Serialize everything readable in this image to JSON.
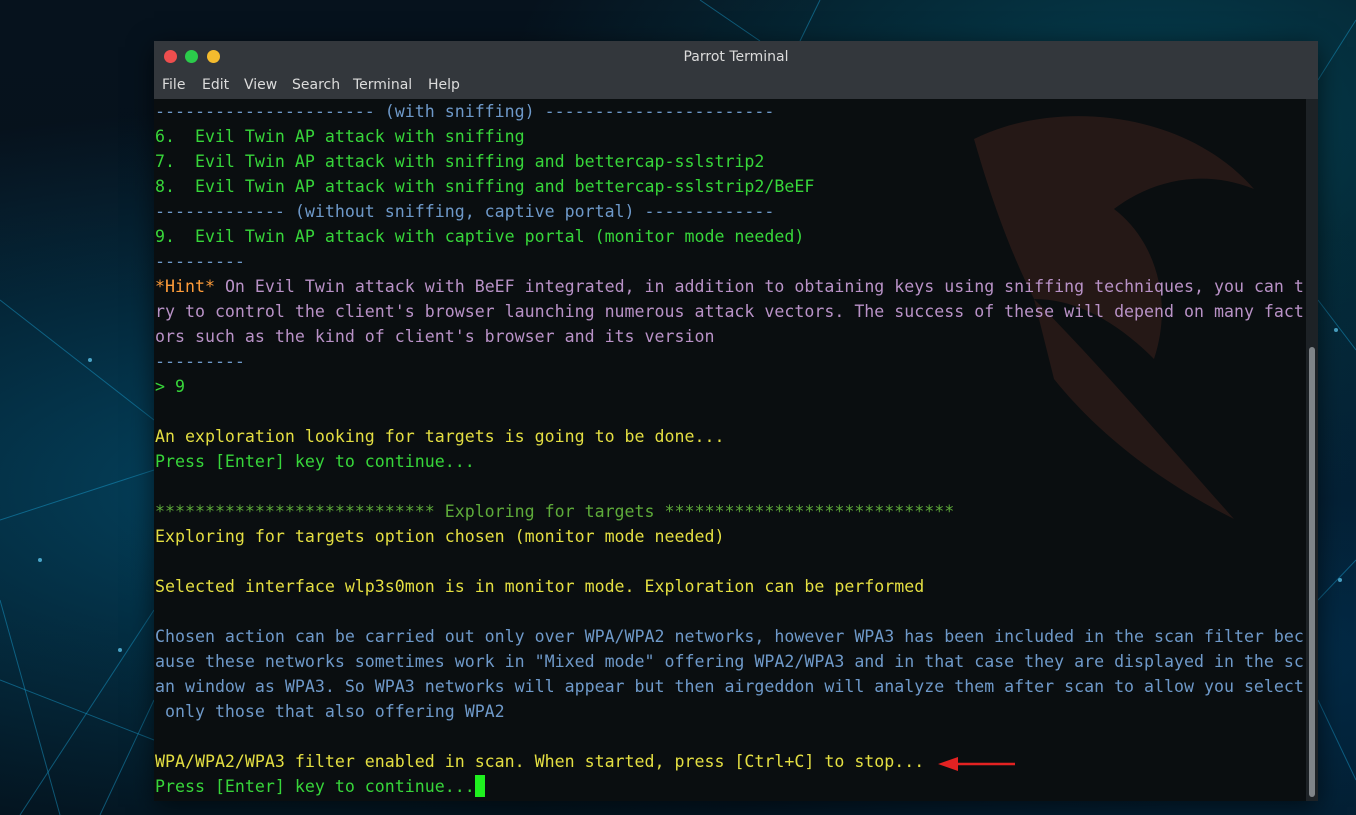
{
  "window": {
    "title": "Parrot Terminal"
  },
  "menu": [
    "File",
    "Edit",
    "View",
    "Search",
    "Terminal",
    "Help"
  ],
  "terminal": {
    "lines": [
      {
        "text": "---------------------- (with sniffing) -----------------------",
        "color": "blue"
      },
      {
        "text": "6.  Evil Twin AP attack with sniffing",
        "color": "green"
      },
      {
        "text": "7.  Evil Twin AP attack with sniffing and bettercap-sslstrip2",
        "color": "green"
      },
      {
        "text": "8.  Evil Twin AP attack with sniffing and bettercap-sslstrip2/BeEF",
        "color": "green"
      },
      {
        "text": "------------- (without sniffing, captive portal) -------------",
        "color": "blue"
      },
      {
        "text": "9.  Evil Twin AP attack with captive portal (monitor mode needed)",
        "color": "green"
      },
      {
        "text": "---------",
        "color": "blue"
      },
      {
        "prefix": "*Hint*",
        "text": " On Evil Twin attack with BeEF integrated, in addition to obtaining keys using sniffing techniques, you can t",
        "color": "purple"
      },
      {
        "text": "ry to control the client's browser launching numerous attack vectors. The success of these will depend on many fact",
        "color": "purple"
      },
      {
        "text": "ors such as the kind of client's browser and its version",
        "color": "purple"
      },
      {
        "text": "---------",
        "color": "blue"
      },
      {
        "text": "> 9",
        "color": "green"
      },
      {
        "text": "",
        "color": "blue"
      },
      {
        "text": "An exploration looking for targets is going to be done...",
        "color": "yellow"
      },
      {
        "text": "Press [Enter] key to continue...",
        "color": "green"
      },
      {
        "text": "",
        "color": "blue"
      },
      {
        "text": "**************************** Exploring for targets *****************************",
        "color": "dim-green"
      },
      {
        "text": "Exploring for targets option chosen (monitor mode needed)",
        "color": "yellow"
      },
      {
        "text": "",
        "color": "blue"
      },
      {
        "text": "Selected interface wlp3s0mon is in monitor mode. Exploration can be performed",
        "color": "yellow"
      },
      {
        "text": "",
        "color": "blue"
      },
      {
        "text": "Chosen action can be carried out only over WPA/WPA2 networks, however WPA3 has been included in the scan filter bec",
        "color": "blue"
      },
      {
        "text": "ause these networks sometimes work in \"Mixed mode\" offering WPA2/WPA3 and in that case they are displayed in the sc",
        "color": "blue"
      },
      {
        "text": "an window as WPA3. So WPA3 networks will appear but then airgeddon will analyze them after scan to allow you select",
        "color": "blue"
      },
      {
        "text": " only those that also offering WPA2",
        "color": "blue"
      },
      {
        "text": "",
        "color": "blue"
      },
      {
        "text": "WPA/WPA2/WPA3 filter enabled in scan. When started, press [Ctrl+C] to stop...",
        "color": "yellow"
      },
      {
        "text": "Press [Enter] key to continue...",
        "color": "green",
        "cursor": true
      }
    ]
  },
  "colors": {
    "blue": "#6e99c9",
    "green": "#37d63a",
    "yellow": "#e4df42",
    "hint": "#ff9d3a",
    "purple": "#b992c7",
    "arrow": "#e32222"
  },
  "icons": {
    "close": "close-dot-icon",
    "minimize": "minimize-dot-icon",
    "maximize": "maximize-dot-icon",
    "annotation": "red-arrow-icon"
  }
}
